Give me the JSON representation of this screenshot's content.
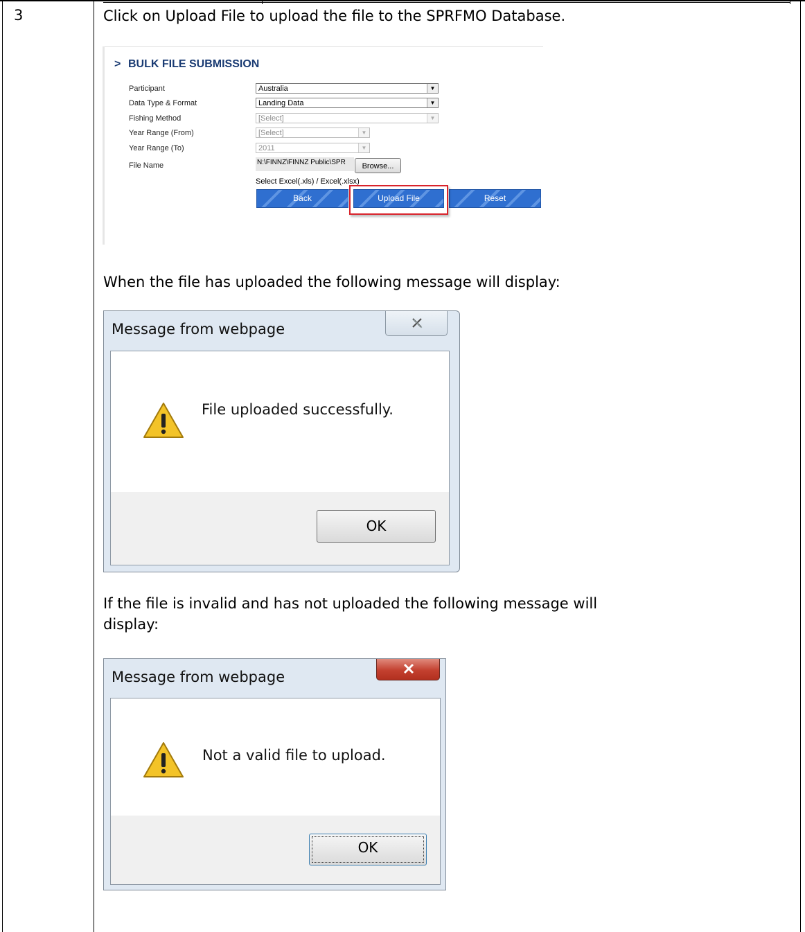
{
  "step": {
    "number": "3"
  },
  "text": {
    "instruction": "Click on Upload File to upload the file to the SPRFMO Database.",
    "success_intro": "When the file has uploaded the following message will  display:",
    "invalid_intro_line1": "If the file is invalid and has not uploaded the following message will",
    "invalid_intro_line2": "display:"
  },
  "bulk_form": {
    "title": "BULK FILE SUBMISSION",
    "chevron": ">",
    "fields": {
      "participant_label": "Participant",
      "participant_value": "Australia",
      "data_type_label": "Data Type & Format",
      "data_type_value": "Landing Data",
      "fishing_method_label": "Fishing Method",
      "fishing_method_value": "[Select]",
      "year_from_label": "Year Range (From)",
      "year_from_value": "[Select]",
      "year_to_label": "Year Range (To)",
      "year_to_value": "2011",
      "file_name_label": "File Name",
      "file_name_value": "N:\\FINNZ\\FINNZ Public\\SPR"
    },
    "browse_label": "Browse...",
    "hint": "Select Excel(.xls) / Excel(.xlsx)",
    "buttons": {
      "back": "Back",
      "upload": "Upload File",
      "reset": "Reset"
    },
    "highlight_color": "#d9232b",
    "button_color": "#2f6fd0"
  },
  "dialog_success": {
    "title": "Message from webpage",
    "message": "File uploaded successfully.",
    "ok": "OK",
    "close_icon": "close-icon"
  },
  "dialog_invalid": {
    "title": "Message from webpage",
    "message": "Not a valid file to upload.",
    "ok": "OK",
    "close_icon": "close-icon",
    "close_color": "#c8463a"
  }
}
